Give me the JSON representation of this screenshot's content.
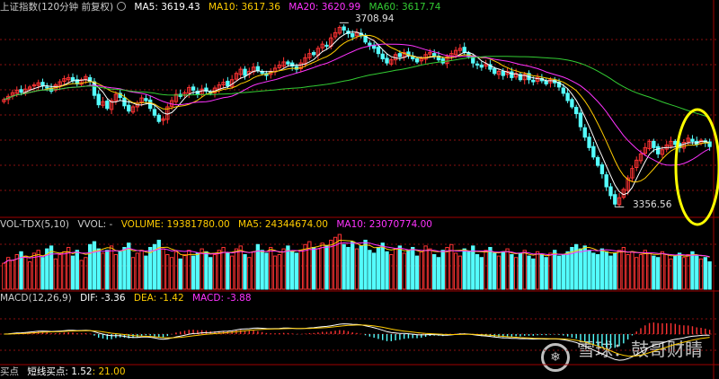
{
  "colors": {
    "up": "#ff3333",
    "down": "#54fcfc",
    "ma5": "#ffffff",
    "ma10": "#ffcc00",
    "ma20": "#ff33ff",
    "ma60": "#33cc33",
    "grid": "#8a1010",
    "panel_line": "#a00000",
    "yellow_highlight": "#ffff00"
  },
  "price_panel": {
    "title": "上证指数(120分钟 前复权)",
    "gear_icon": "gear-icon",
    "ma5": "MA5: 3619.43",
    "ma10": "MA10: 3617.36",
    "ma20": "MA20: 3620.99",
    "ma60": "MA60: 3617.74",
    "high_label": "3708.94",
    "low_label": "3356.56"
  },
  "volume_panel": {
    "title": "VOL-TDX(5,10)",
    "vvol": "VVOL: -",
    "volume": "VOLUME: 19381780.00",
    "ma5": "MA5: 24344674.00",
    "ma10": "MA10: 23070774.00"
  },
  "macd_panel": {
    "title": "MACD(12,26,9)",
    "dif": "DIF: -3.36",
    "dea": "DEA: -1.42",
    "macd": "MACD: -3.88"
  },
  "bottom_panel": {
    "title": "买点",
    "label": "短线买点: 1.52",
    "value": ": 21.00"
  },
  "watermark": {
    "logo_char": "❄",
    "text": "雪球：鼓哥财睛"
  },
  "chart_data": {
    "type": "candlestick",
    "price_range": [
      3340,
      3725
    ],
    "high": 3708.94,
    "low": 3356.56,
    "closes": [
      3562,
      3568,
      3575,
      3580,
      3576,
      3582,
      3586,
      3590,
      3594,
      3588,
      3584,
      3578,
      3590,
      3596,
      3602,
      3604,
      3598,
      3592,
      3600,
      3606,
      3596,
      3570,
      3552,
      3558,
      3545,
      3560,
      3572,
      3566,
      3550,
      3540,
      3548,
      3555,
      3565,
      3560,
      3545,
      3532,
      3520,
      3525,
      3548,
      3560,
      3572,
      3568,
      3575,
      3585,
      3580,
      3572,
      3582,
      3578,
      3574,
      3584,
      3590,
      3595,
      3588,
      3600,
      3612,
      3620,
      3608,
      3616,
      3624,
      3618,
      3612,
      3608,
      3616,
      3622,
      3628,
      3634,
      3630,
      3626,
      3620,
      3632,
      3642,
      3650,
      3648,
      3660,
      3668,
      3664,
      3680,
      3690,
      3700,
      3695,
      3688,
      3682,
      3690,
      3684,
      3672,
      3666,
      3660,
      3650,
      3640,
      3632,
      3638,
      3648,
      3644,
      3652,
      3646,
      3640,
      3634,
      3640,
      3648,
      3652,
      3645,
      3638,
      3632,
      3644,
      3650,
      3656,
      3660,
      3652,
      3644,
      3632,
      3628,
      3624,
      3630,
      3620,
      3612,
      3616,
      3608,
      3616,
      3604,
      3612,
      3600,
      3610,
      3600,
      3596,
      3604,
      3598,
      3592,
      3600,
      3594,
      3586,
      3574,
      3560,
      3548,
      3535,
      3510,
      3490,
      3470,
      3452,
      3436,
      3420,
      3395,
      3378,
      3362,
      3374,
      3390,
      3412,
      3430,
      3446,
      3458,
      3470,
      3482,
      3470,
      3458,
      3466,
      3475,
      3482,
      3476,
      3470,
      3480,
      3488,
      3482,
      3476,
      3484,
      3480,
      3472
    ],
    "volumes": [
      18,
      22,
      20,
      24,
      26,
      23,
      19,
      25,
      27,
      22,
      28,
      30,
      21,
      24,
      26,
      29,
      23,
      27,
      20,
      22,
      31,
      33,
      28,
      25,
      27,
      30,
      24,
      26,
      29,
      32,
      22,
      25,
      27,
      23,
      29,
      31,
      34,
      28,
      24,
      22,
      26,
      21,
      24,
      27,
      23,
      25,
      28,
      26,
      22,
      24,
      27,
      29,
      25,
      23,
      28,
      30,
      24,
      22,
      26,
      31,
      27,
      25,
      29,
      23,
      24,
      28,
      30,
      26,
      25,
      27,
      31,
      33,
      29,
      28,
      32,
      30,
      34,
      36,
      38,
      31,
      29,
      33,
      28,
      30,
      34,
      27,
      25,
      29,
      32,
      26,
      24,
      28,
      30,
      25,
      27,
      29,
      23,
      26,
      30,
      28,
      24,
      22,
      27,
      29,
      31,
      25,
      23,
      28,
      26,
      30,
      24,
      22,
      27,
      29,
      25,
      23,
      26,
      28,
      24,
      22,
      25,
      27,
      23,
      21,
      26,
      24,
      22,
      25,
      27,
      23,
      24,
      26,
      29,
      31,
      28,
      30,
      27,
      25,
      24,
      28,
      26,
      23,
      25,
      27,
      29,
      24,
      26,
      22,
      24,
      27,
      25,
      23,
      22,
      26,
      24,
      21,
      23,
      25,
      22,
      24,
      26,
      23,
      21,
      22,
      19
    ]
  }
}
